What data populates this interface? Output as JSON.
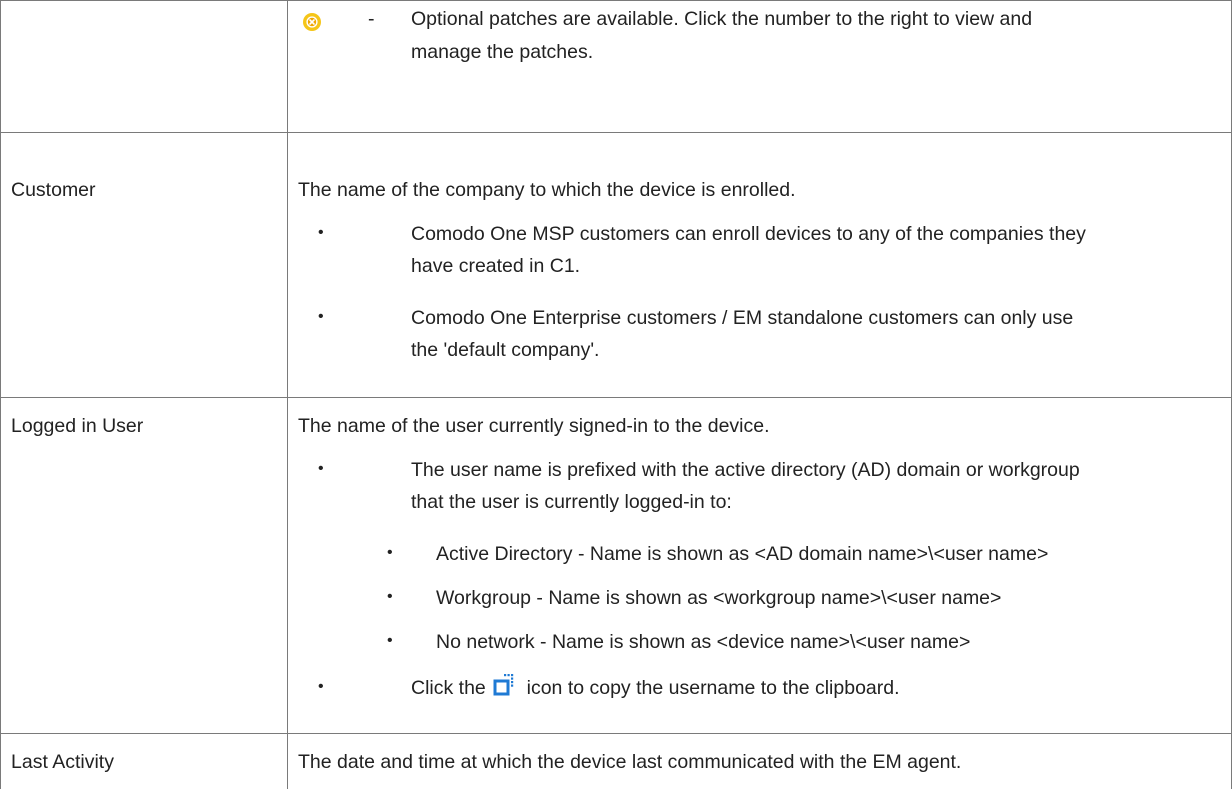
{
  "rows": [
    {
      "label": "",
      "intro": "",
      "status_icon": "yellow-cross-circle-icon",
      "dash": "-",
      "lines": [
        "Optional patches are available. Click the number to the right to view and",
        "manage the patches."
      ]
    },
    {
      "label": "Customer",
      "intro": "The name of the company to which the device is enrolled.",
      "bullets": [
        [
          "Comodo One MSP customers can enroll devices to any of the companies they",
          "have created in C1."
        ],
        [
          "Comodo One Enterprise customers / EM standalone customers can only use",
          "the 'default company'."
        ]
      ]
    },
    {
      "label": "Logged in User",
      "intro": "The name of the user currently signed-in to the device.",
      "bullets": [
        [
          "The user name is prefixed with the active directory (AD) domain or workgroup",
          "that the user is currently logged-in to:"
        ]
      ],
      "sub_bullets": [
        "Active Directory - Name is shown as <AD domain name>\\<user name>",
        "Workgroup - Name is shown as <workgroup name>\\<user name>",
        "No network - Name is shown as <device name>\\<user name>"
      ],
      "copy_line": {
        "before": "Click the",
        "icon": "copy-icon",
        "after": "icon to copy the username to the clipboard."
      }
    },
    {
      "label": "Last Activity",
      "intro": "The date and time at which the device last communicated with the EM agent."
    }
  ],
  "colors": {
    "border": "#7a7a7a",
    "text": "#222222",
    "status_icon": "#f5c518",
    "copy_icon": "#1f7ad4"
  }
}
